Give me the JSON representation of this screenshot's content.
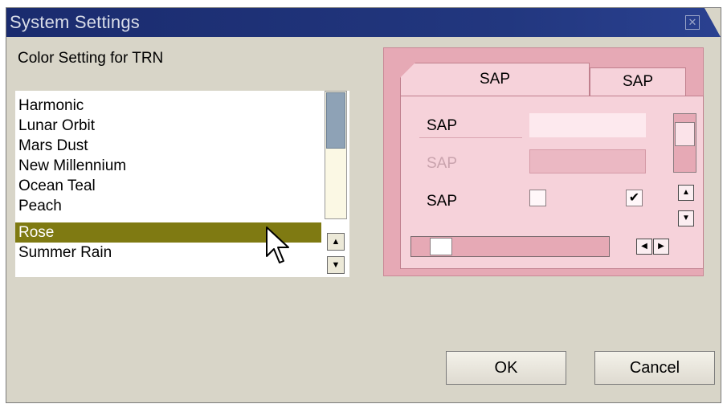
{
  "window": {
    "title": "System Settings",
    "close_icon": "close-icon"
  },
  "settings": {
    "label": "Color Setting for TRN",
    "themes": [
      "Harmonic",
      "Lunar Orbit",
      "Mars Dust",
      "New Millennium",
      "Ocean Teal",
      "Peach",
      "Rose",
      "Summer Rain"
    ],
    "selected": "Rose"
  },
  "preview": {
    "tabs": [
      "SAP",
      "SAP"
    ],
    "row1_label": "SAP",
    "row2_label": "SAP",
    "row3_label": "SAP",
    "checkbox1_checked": false,
    "checkbox2_checked": true,
    "check_glyph": "✔"
  },
  "buttons": {
    "ok": "OK",
    "cancel": "Cancel"
  },
  "colors": {
    "title_bar": "#1f3279",
    "dialog_bg": "#d8d5c8",
    "selection": "#7f7a12",
    "preview_bg": "#e6a9b5"
  }
}
